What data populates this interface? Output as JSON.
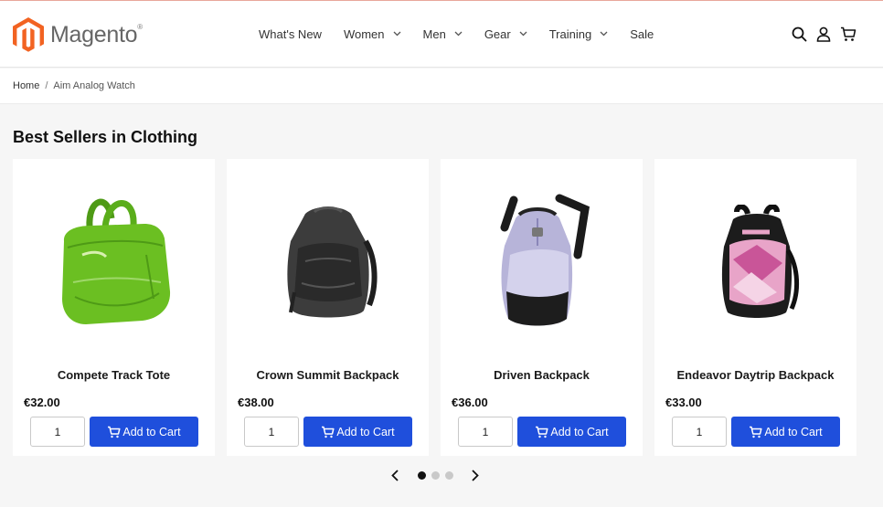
{
  "brand": {
    "name": "Magento",
    "trademark": "®",
    "logo_color": "#f26322"
  },
  "nav": {
    "items": [
      {
        "label": "What's New",
        "has_dropdown": false
      },
      {
        "label": "Women",
        "has_dropdown": true
      },
      {
        "label": "Men",
        "has_dropdown": true
      },
      {
        "label": "Gear",
        "has_dropdown": true
      },
      {
        "label": "Training",
        "has_dropdown": true
      },
      {
        "label": "Sale",
        "has_dropdown": false
      }
    ]
  },
  "header_icons": [
    "search-icon",
    "account-icon",
    "cart-icon"
  ],
  "breadcrumb": {
    "home": "Home",
    "separator": "/",
    "current": "Aim Analog Watch"
  },
  "section": {
    "title": "Best Sellers in Clothing"
  },
  "products": [
    {
      "name": "Compete Track Tote",
      "price": "€32.00",
      "qty": "1",
      "cta": "Add to Cart",
      "image": "green-tote-bag"
    },
    {
      "name": "Crown Summit Backpack",
      "price": "€38.00",
      "qty": "1",
      "cta": "Add to Cart",
      "image": "black-backpack"
    },
    {
      "name": "Driven Backpack",
      "price": "€36.00",
      "qty": "1",
      "cta": "Add to Cart",
      "image": "lavender-backpack"
    },
    {
      "name": "Endeavor Daytrip Backpack",
      "price": "€33.00",
      "qty": "1",
      "cta": "Add to Cart",
      "image": "pink-black-backpack"
    }
  ],
  "carousel": {
    "pages": 3,
    "active_page": 1
  },
  "colors": {
    "accent": "#1f4fdc",
    "brand_orange": "#f26322"
  }
}
